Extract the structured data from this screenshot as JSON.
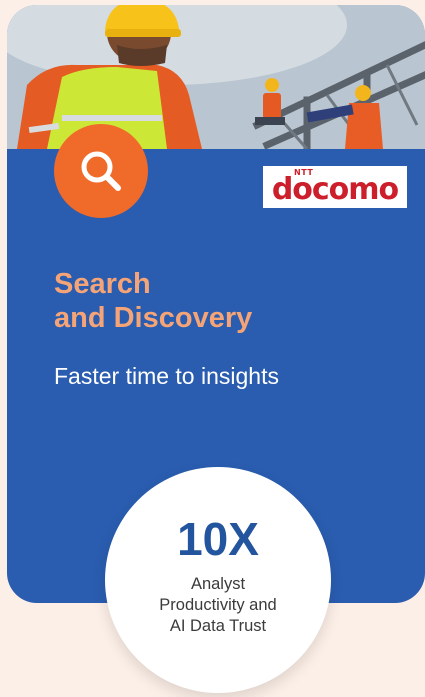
{
  "card": {
    "background_color": "#2a5db0",
    "hero_image": "construction-workers-photo",
    "search_icon": "search-icon",
    "logo": {
      "ntt": "NTT",
      "wordmark": "docomo"
    },
    "title_lines": [
      "Search",
      "and Discovery"
    ],
    "subtitle": "Faster time to insights",
    "stat": {
      "value": "10X",
      "label_lines": [
        "Analyst",
        "Productivity and",
        "AI Data Trust"
      ]
    }
  },
  "colors": {
    "accent_orange": "#f06a2a",
    "title_peach": "#f5a477",
    "page_background": "#fcefe7",
    "stat_blue": "#23559f"
  }
}
